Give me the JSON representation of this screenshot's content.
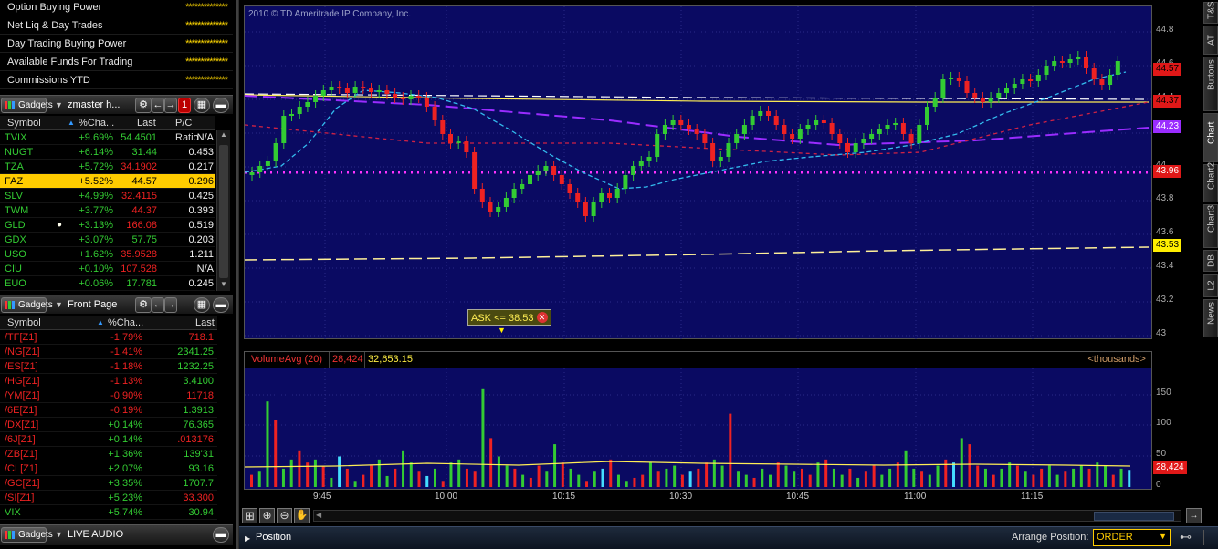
{
  "account": {
    "rows": [
      {
        "label": "Option Buying Power",
        "value": "**************"
      },
      {
        "label": "Net Liq & Day Trades",
        "value": "**************"
      },
      {
        "label": "Day Trading Buying Power",
        "value": "**************"
      },
      {
        "label": "Available Funds For Trading",
        "value": "**************"
      },
      {
        "label": "Commissions YTD",
        "value": "**************"
      }
    ]
  },
  "watchlist1": {
    "gadgets_label": "Gadgets",
    "title": "zmaster h...",
    "columns": [
      "Symbol",
      "%Cha...",
      "Last",
      "P/C Ratio"
    ],
    "rows": [
      {
        "sym": "TVIX",
        "chg": "+9.69%",
        "last": "54.4501",
        "pc": "N/A",
        "dir": "up"
      },
      {
        "sym": "NUGT",
        "chg": "+6.14%",
        "last": "31.44",
        "pc": "0.453",
        "dir": "up"
      },
      {
        "sym": "TZA",
        "chg": "+5.72%",
        "last": "34.1902",
        "pc": "0.217",
        "dir": "down"
      },
      {
        "sym": "FAZ",
        "chg": "+5.52%",
        "last": "44.57",
        "pc": "0.296",
        "dir": "up"
      },
      {
        "sym": "SLV",
        "chg": "+4.99%",
        "last": "32.4115",
        "pc": "0.425",
        "dir": "down"
      },
      {
        "sym": "TWM",
        "chg": "+3.77%",
        "last": "44.37",
        "pc": "0.393",
        "dir": "down"
      },
      {
        "sym": "GLD",
        "chg": "+3.13%",
        "last": "166.08",
        "pc": "0.519",
        "dir": "down"
      },
      {
        "sym": "GDX",
        "chg": "+3.07%",
        "last": "57.75",
        "pc": "0.203",
        "dir": "up"
      },
      {
        "sym": "USO",
        "chg": "+1.62%",
        "last": "35.9528",
        "pc": "1.211",
        "dir": "down"
      },
      {
        "sym": "CIU",
        "chg": "+0.10%",
        "last": "107.528",
        "pc": "N/A",
        "dir": "down"
      },
      {
        "sym": "EUO",
        "chg": "+0.06%",
        "last": "17.781",
        "pc": "0.245",
        "dir": "up"
      }
    ]
  },
  "watchlist2": {
    "gadgets_label": "Gadgets",
    "title": "Front Page",
    "columns": [
      "Symbol",
      "%Cha...",
      "Last"
    ],
    "rows": [
      {
        "sym": "/TF[Z1]",
        "chg": "-1.79%",
        "last": "718.1",
        "dir": "down"
      },
      {
        "sym": "/NG[Z1]",
        "chg": "-1.41%",
        "last": "2341.25",
        "dir": "up"
      },
      {
        "sym": "/ES[Z1]",
        "chg": "-1.18%",
        "last": "1232.25",
        "dir": "up"
      },
      {
        "sym": "/HG[Z1]",
        "chg": "-1.13%",
        "last": "3.4100",
        "dir": "up"
      },
      {
        "sym": "/YM[Z1]",
        "chg": "-0.90%",
        "last": "11718",
        "dir": "down"
      },
      {
        "sym": "/6E[Z1]",
        "chg": "-0.19%",
        "last": "1.3913",
        "dir": "up"
      },
      {
        "sym": "/DX[Z1]",
        "chg": "+0.14%",
        "last": "76.365",
        "dir": "up"
      },
      {
        "sym": "/6J[Z1]",
        "chg": "+0.14%",
        "last": ".013176",
        "dir": "down"
      },
      {
        "sym": "/ZB[Z1]",
        "chg": "+1.36%",
        "last": "139'31",
        "dir": "up"
      },
      {
        "sym": "/CL[Z1]",
        "chg": "+2.07%",
        "last": "93.16",
        "dir": "up"
      },
      {
        "sym": "/GC[Z1]",
        "chg": "+3.35%",
        "last": "1707.7",
        "dir": "up"
      },
      {
        "sym": "/SI[Z1]",
        "chg": "+5.23%",
        "last": "33.300",
        "dir": "down"
      },
      {
        "sym": "VIX",
        "chg": "+5.74%",
        "last": "30.94",
        "dir": "up"
      }
    ]
  },
  "live_audio": {
    "gadgets_label": "Gadgets",
    "title": "LIVE AUDIO"
  },
  "chart": {
    "copyright": "2010 © TD Ameritrade IP Company, Inc.",
    "price_ticks": [
      "44.8",
      "44.6",
      "44.4",
      "44.2",
      "44",
      "43.8",
      "43.6",
      "43.4",
      "43.2",
      "43"
    ],
    "price_tags": [
      {
        "text": "44.57",
        "bg": "#e01818",
        "fg": "#000"
      },
      {
        "text": "44.37",
        "bg": "#e01818",
        "fg": "#000"
      },
      {
        "text": "44.23",
        "bg": "#9a2cff",
        "fg": "#fff"
      },
      {
        "text": "43.96",
        "bg": "#e01818",
        "fg": "#fff"
      },
      {
        "text": "43.53",
        "bg": "#ffee00",
        "fg": "#000"
      }
    ],
    "ask_alert": "ASK <= 38.53",
    "volume_label": "VolumeAvg (20)",
    "volume_value1": "28,424",
    "volume_value2": "32,653.15",
    "volume_units": "<thousands>",
    "volume_ticks": [
      "150",
      "100",
      "50",
      "0"
    ],
    "volume_tag": "28,424",
    "time_ticks": [
      "9:45",
      "10:00",
      "10:15",
      "10:30",
      "10:45",
      "11:00",
      "11:15"
    ]
  },
  "side_tabs": [
    "T&S",
    "AT",
    "Buttons",
    "Chart",
    "Chart2",
    "Chart3",
    "DB",
    "L2",
    "News"
  ],
  "bottom": {
    "position_label": "Position",
    "arrange_label": "Arrange Position:",
    "arrange_value": "ORDER"
  },
  "colors": {
    "up": "#33cc33",
    "down": "#ee2222",
    "panel_bg": "#0a0a62",
    "highlight": "#ffcc00"
  },
  "icons": [
    "gear-icon",
    "arrow-left-icon",
    "arrow-right-icon",
    "close-icon",
    "print-icon",
    "zoom-in-icon",
    "zoom-out-icon",
    "hand-icon",
    "grid-icon",
    "audio-icon"
  ]
}
